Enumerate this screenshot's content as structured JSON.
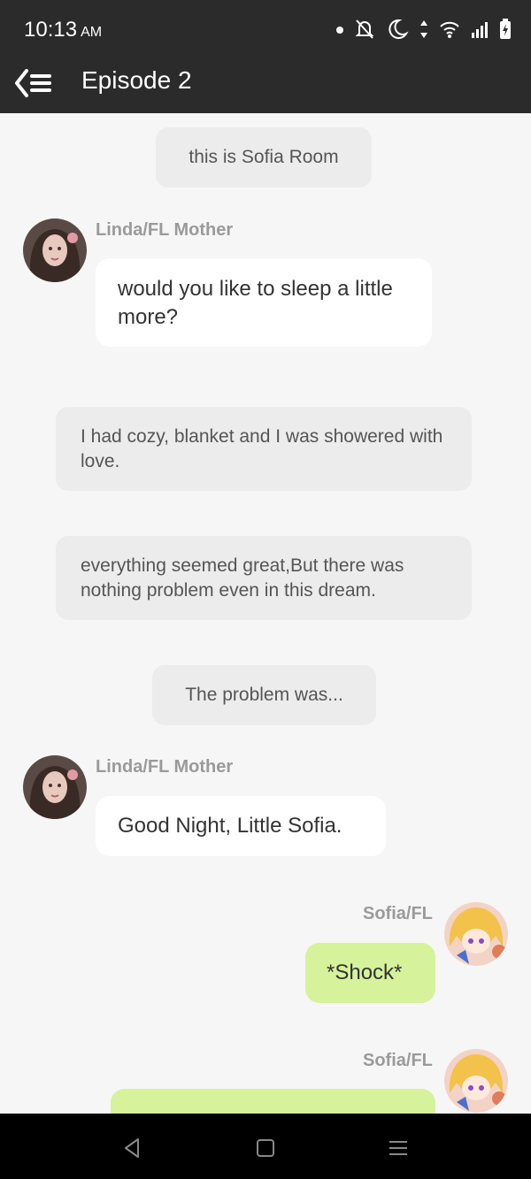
{
  "status": {
    "time": "10:13",
    "ampm": "AM"
  },
  "header": {
    "title": "Episode 2"
  },
  "messages": {
    "m1": "this is Sofia Room",
    "m2_speaker": "Linda/FL Mother",
    "m2_text": "would you like to sleep a little more?",
    "m3": "I had cozy, blanket and I was showered with love.",
    "m4": "everything seemed great,But there was nothing problem even in this dream.",
    "m5": "The problem was...",
    "m6_speaker": "Linda/FL Mother",
    "m6_text": "Good Night, Little Sofia.",
    "m7_speaker": "Sofia/FL",
    "m7_text": "*Shock*",
    "m8_speaker": "Sofia/FL"
  },
  "colors": {
    "topbar": "#2b2b2b",
    "background": "#f6f6f6",
    "narration_bubble": "#ececec",
    "character_bubble": "#ffffff",
    "player_bubble": "#d6f29a"
  }
}
